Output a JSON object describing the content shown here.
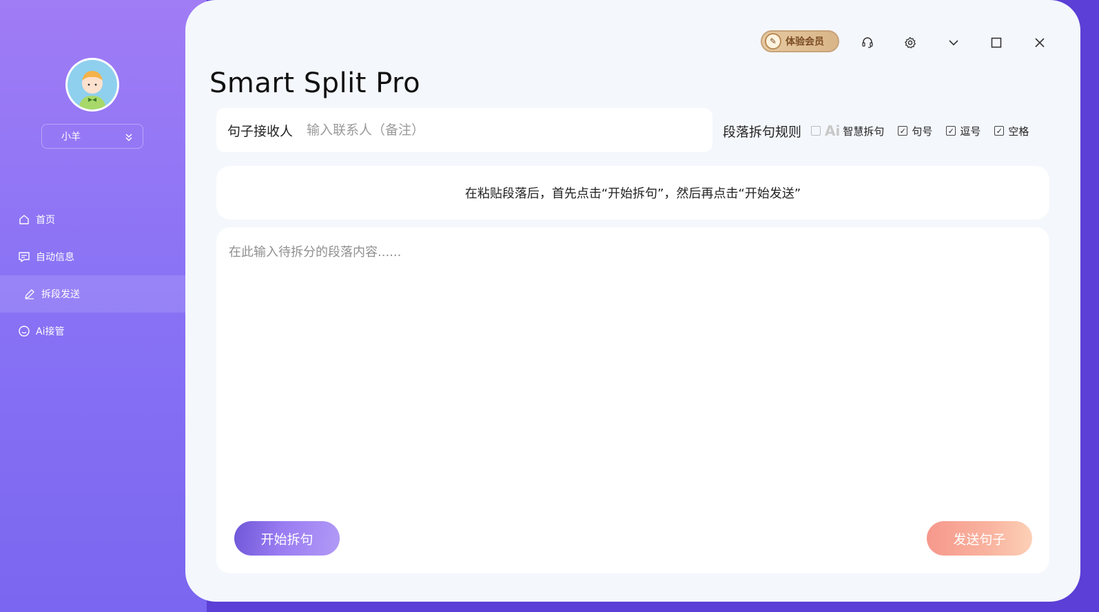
{
  "sidebar": {
    "user_name": "小羊",
    "nav": [
      {
        "label": "首页",
        "icon": "home-icon"
      },
      {
        "label": "自动信息",
        "icon": "message-icon"
      },
      {
        "label": "拆段发送",
        "icon": "edit-icon",
        "active": true
      },
      {
        "label": "Ai接管",
        "icon": "smile-icon"
      }
    ]
  },
  "header": {
    "vip_label": "体验会员",
    "app_title": "Smart Split Pro",
    "icons": [
      "headset-icon",
      "settings-icon",
      "minimize-icon",
      "maximize-icon",
      "close-icon"
    ]
  },
  "recipient": {
    "label": "句子接收人",
    "placeholder": "输入联系人（备注）"
  },
  "rules": {
    "title": "段落拆句规则",
    "options": [
      {
        "mark": "Ai",
        "label": "智慧拆句",
        "checked": false
      },
      {
        "label": "句号",
        "checked": true
      },
      {
        "label": "逗号",
        "checked": true
      },
      {
        "label": "空格",
        "checked": true
      }
    ]
  },
  "hint": "在粘贴段落后，首先点击“开始拆句”，然后再点击“开始发送”",
  "editor": {
    "placeholder": "在此输入待拆分的段落内容......"
  },
  "buttons": {
    "split": "开始拆句",
    "send": "发送句子"
  },
  "colors": {
    "sidebar_top": "#a07cf5",
    "sidebar_bottom": "#7a66f0",
    "split_button": "#8a6de8",
    "send_button": "#f9b4a0"
  }
}
